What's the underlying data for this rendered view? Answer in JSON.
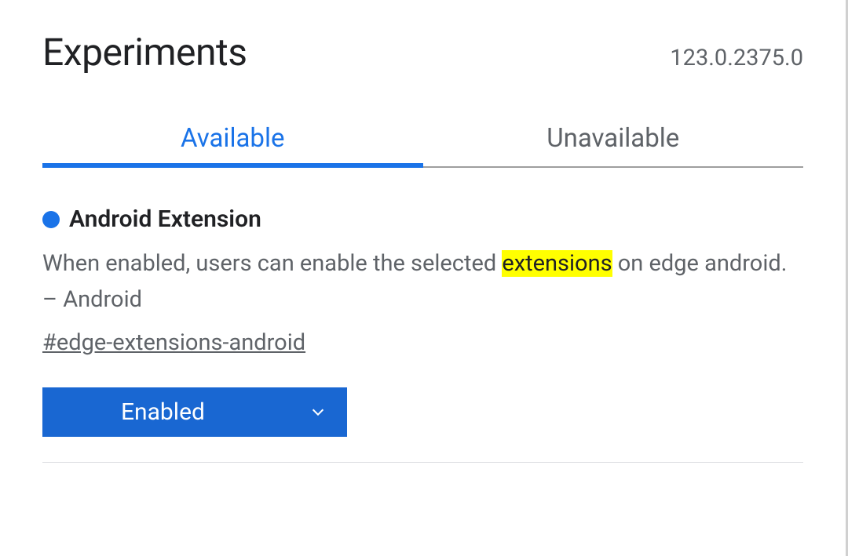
{
  "header": {
    "title": "Experiments",
    "version": "123.0.2375.0"
  },
  "tabs": {
    "available_label": "Available",
    "unavailable_label": "Unavailable"
  },
  "experiment": {
    "title": "Android Extension",
    "desc_prefix": "When enabled, users can enable the selected ",
    "desc_highlight": "extensions",
    "desc_suffix": " on edge android. – Android",
    "anchor": "#edge-extensions-android",
    "dropdown_value": "Enabled"
  }
}
